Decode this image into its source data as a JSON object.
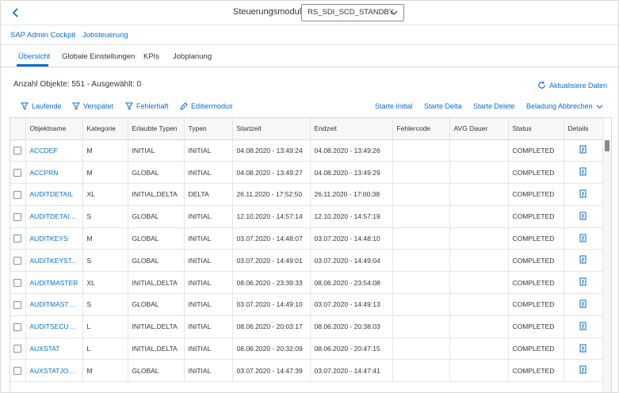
{
  "header": {
    "module_label": "Steuerungsmodul",
    "module_selected": "RS_SDI_SCD_STANDBY"
  },
  "nav": {
    "items": [
      "SAP Admin Cockpit",
      "Jobsteuerung"
    ]
  },
  "tabs": {
    "items": [
      "Übersicht",
      "Globale Einstellungen",
      "KPIs",
      "Jobplanung"
    ],
    "active_index": 0
  },
  "summary": {
    "count_text": "Anzahl Objekte: 551 - Ausgewählt: 0",
    "refresh_label": "Aktualisiere Daten"
  },
  "toolbar": {
    "filters": [
      {
        "label": "Laufende",
        "icon": "filter-icon"
      },
      {
        "label": "Verspätet",
        "icon": "filter-icon"
      },
      {
        "label": "Fehlerhaft",
        "icon": "filter-icon"
      },
      {
        "label": "Editiermodus",
        "icon": "edit-icon"
      }
    ],
    "actions": [
      "Starte Initial",
      "Starte Delta",
      "Starte Delete",
      "Beladung Abbrechen"
    ]
  },
  "table": {
    "columns": [
      "Objektname",
      "Kategorie",
      "Erlaubte Typen",
      "Typen",
      "Startzeit",
      "Endzeit",
      "Fehlercode",
      "AVG Dauer",
      "Status",
      "Details"
    ],
    "rows": [
      [
        "ACCDEF",
        "M",
        "INITIAL",
        "INITIAL",
        "04.08.2020 - 13:49:24",
        "04.08.2020 - 13:49:26",
        "",
        "",
        "COMPLETED"
      ],
      [
        "ACCPRN",
        "M",
        "GLOBAL",
        "INITIAL",
        "04.08.2020 - 13:49:27",
        "04.08.2020 - 13:49:29",
        "",
        "",
        "COMPLETED"
      ],
      [
        "AUDITDETAIL",
        "XL",
        "INITIAL,DELTA",
        "DELTA",
        "26.11.2020 - 17:52:50",
        "26.11.2020 - 17:00:38",
        "",
        "",
        "COMPLETED"
      ],
      [
        "AUDITDETAIL...",
        "S",
        "GLOBAL",
        "INITIAL",
        "12.10.2020 - 14:57:14",
        "12.10.2020 - 14:57:19",
        "",
        "",
        "COMPLETED"
      ],
      [
        "AUDITKEYS",
        "M",
        "GLOBAL",
        "INITIAL",
        "03.07.2020 - 14:48:07",
        "03.07.2020 - 14:48:10",
        "",
        "",
        "COMPLETED"
      ],
      [
        "AUDITKEYST...",
        "S",
        "GLOBAL",
        "INITIAL",
        "03.07.2020 - 14:49:01",
        "03.07.2020 - 14:49:04",
        "",
        "",
        "COMPLETED"
      ],
      [
        "AUDITMASTER",
        "XL",
        "INITIAL,DELTA",
        "INITIAL",
        "08.06.2020 - 23:39:33",
        "08.06.2020 - 23:54:08",
        "",
        "",
        "COMPLETED"
      ],
      [
        "AUDITMASTE...",
        "S",
        "GLOBAL",
        "INITIAL",
        "03.07.2020 - 14:49:10",
        "03.07.2020 - 14:49:13",
        "",
        "",
        "COMPLETED"
      ],
      [
        "AUDITSECUR...",
        "L",
        "INITIAL,DELTA",
        "INITIAL",
        "08.06.2020 - 20:03:17",
        "08.06.2020 - 20:38:03",
        "",
        "",
        "COMPLETED"
      ],
      [
        "AUXSTAT",
        "L",
        "INITIAL,DELTA",
        "INITIAL",
        "08.06.2020 - 20:32:09",
        "08.06.2020 - 20:47:15",
        "",
        "",
        "COMPLETED"
      ],
      [
        "AUXSTATJOB...",
        "M",
        "GLOBAL",
        "INITIAL",
        "03.07.2020 - 14:47:39",
        "03.07.2020 - 14:47:41",
        "",
        "",
        "COMPLETED"
      ]
    ]
  },
  "colors": {
    "accent": "#0a6ed1",
    "text": "#32363a",
    "border": "#e5e5e5"
  }
}
